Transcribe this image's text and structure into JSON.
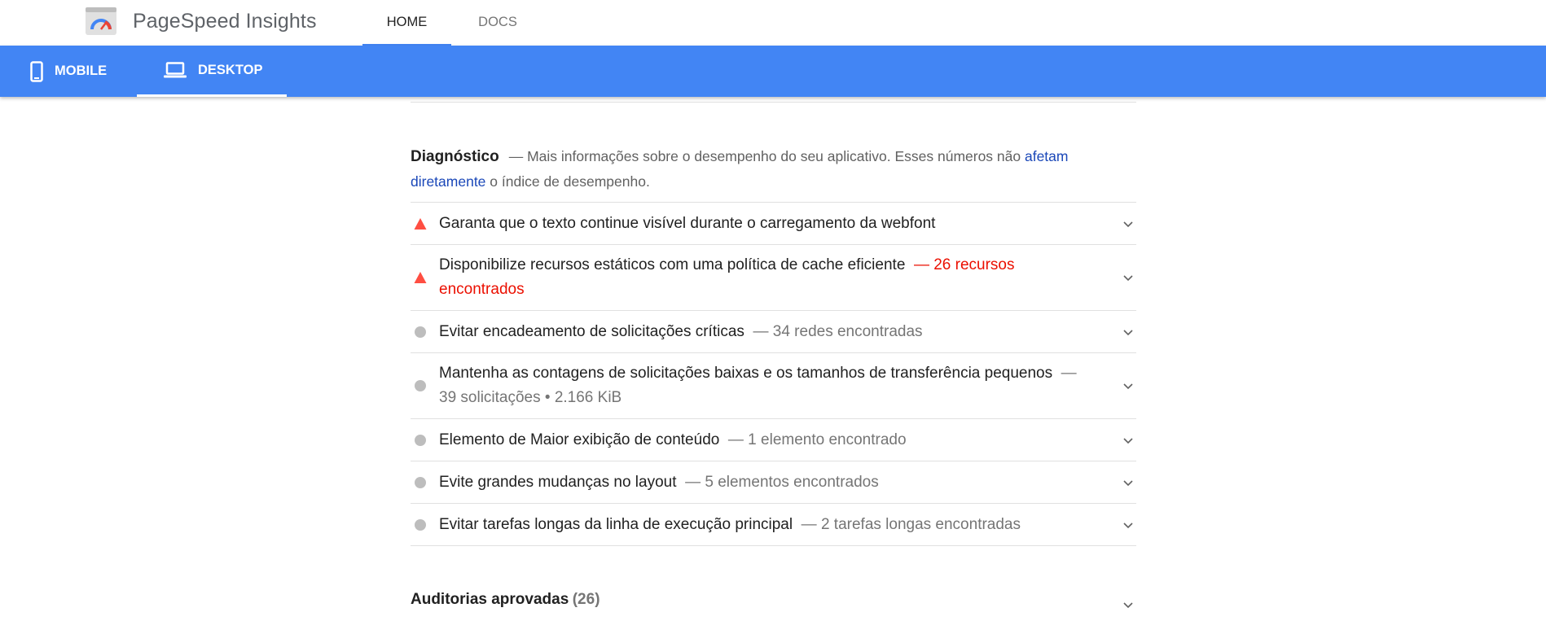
{
  "header": {
    "brand": "PageSpeed Insights",
    "logo_icon": "pagespeed-gauge-icon",
    "tabs": [
      {
        "label": "HOME",
        "active": true
      },
      {
        "label": "DOCS",
        "active": false
      }
    ]
  },
  "device_bar": {
    "color": "#4285f4",
    "tabs": [
      {
        "label": "MOBILE",
        "icon": "phone-icon",
        "active": false
      },
      {
        "label": "DESKTOP",
        "icon": "laptop-icon",
        "active": true
      }
    ]
  },
  "diagnostics": {
    "title": "Diagnóstico",
    "description_prefix": "— Mais informações sobre o desempenho do seu aplicativo. Esses números não ",
    "link_text": "afetam diretamente",
    "description_suffix": " o índice de desempenho.",
    "audits": [
      {
        "status": "fail",
        "title": "Garanta que o texto continue visível durante o carregamento da webfont",
        "detail": ""
      },
      {
        "status": "fail",
        "title": "Disponibilize recursos estáticos com uma política de cache eficiente",
        "detail": "— 26 recursos encontrados"
      },
      {
        "status": "info",
        "title": "Evitar encadeamento de solicitações críticas",
        "detail": "— 34 redes encontradas"
      },
      {
        "status": "info",
        "title": "Mantenha as contagens de solicitações baixas e os tamanhos de transferência pequenos",
        "detail": "— 39 solicitações • 2.166 KiB"
      },
      {
        "status": "info",
        "title": "Elemento de Maior exibição de conteúdo",
        "detail": "— 1 elemento encontrado"
      },
      {
        "status": "info",
        "title": "Evite grandes mudanças no layout",
        "detail": "— 5 elementos encontrados"
      },
      {
        "status": "info",
        "title": "Evitar tarefas longas da linha de execução principal",
        "detail": "— 2 tarefas longas encontradas"
      }
    ]
  },
  "passed_audits": {
    "label": "Auditorias aprovadas",
    "count": "(26)"
  },
  "colors": {
    "fail": "#ff4e42",
    "fail_text": "#eb0f00",
    "neutral": "#bdbdbd",
    "link": "#1a47b8"
  }
}
